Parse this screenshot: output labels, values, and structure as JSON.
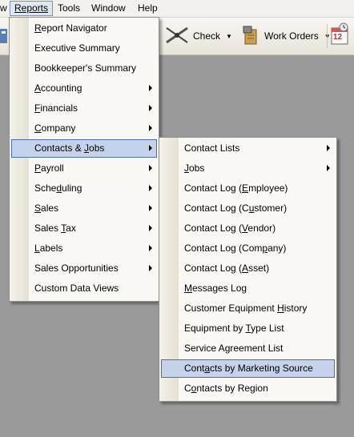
{
  "menubar": {
    "cut_item": "w",
    "items": [
      {
        "label": "Reports"
      },
      {
        "label": "Tools"
      },
      {
        "label": "Window"
      },
      {
        "label": "Help"
      }
    ]
  },
  "toolbar": {
    "check_label": "Check",
    "work_orders_label": "Work Orders",
    "calendar_badge": "12"
  },
  "reports_menu": {
    "items": [
      {
        "label": "Report Navigator",
        "ul": "R",
        "has_submenu": false
      },
      {
        "label": "Executive Summary",
        "ul": "",
        "has_submenu": false
      },
      {
        "label": "Bookkeeper's Summary",
        "ul": "",
        "has_submenu": false
      },
      {
        "label": "Accounting",
        "ul": "A",
        "has_submenu": true
      },
      {
        "label": "Financials",
        "ul": "F",
        "has_submenu": true
      },
      {
        "label": "Company",
        "ul": "C",
        "has_submenu": true
      },
      {
        "label": "Contacts & Jobs",
        "ul": "J",
        "has_submenu": true,
        "selected": true
      },
      {
        "label": "Payroll",
        "ul": "P",
        "has_submenu": true
      },
      {
        "label": "Scheduling",
        "ul": "d",
        "has_submenu": true
      },
      {
        "label": "Sales",
        "ul": "S",
        "has_submenu": true
      },
      {
        "label": "Sales Tax",
        "ul": "T",
        "has_submenu": true
      },
      {
        "label": "Labels",
        "ul": "L",
        "has_submenu": true
      },
      {
        "label": "Sales Opportunities",
        "ul": "",
        "has_submenu": true
      },
      {
        "label": "Custom Data Views",
        "ul": "",
        "has_submenu": false
      }
    ]
  },
  "contacts_menu": {
    "items": [
      {
        "label": "Contact Lists",
        "ul": "",
        "has_submenu": true
      },
      {
        "label": "Jobs",
        "ul": "J",
        "has_submenu": true
      },
      {
        "label": "Contact Log (Employee)",
        "ul": "E",
        "has_submenu": false
      },
      {
        "label": "Contact Log (Customer)",
        "ul": "u",
        "has_submenu": false
      },
      {
        "label": "Contact Log (Vendor)",
        "ul": "V",
        "has_submenu": false
      },
      {
        "label": "Contact Log (Company)",
        "ul": "p",
        "has_submenu": false
      },
      {
        "label": "Contact Log (Asset)",
        "ul": "A",
        "has_submenu": false
      },
      {
        "label": "Messages Log",
        "ul": "M",
        "has_submenu": false
      },
      {
        "label": "Customer Equipment History",
        "ul": "H",
        "has_submenu": false
      },
      {
        "label": "Equipment by Type List",
        "ul": "T",
        "has_submenu": false
      },
      {
        "label": "Service Agreement List",
        "ul": "",
        "has_submenu": false
      },
      {
        "label": "Contacts by Marketing Source",
        "ul": "a",
        "has_submenu": false,
        "selected": true
      },
      {
        "label": "Contacts by Region",
        "ul": "o",
        "has_submenu": false
      }
    ]
  },
  "colors": {
    "desktop": "#9a9a9a",
    "menu_bg": "#f9f8f4",
    "highlight_bg": "#c5d3ea",
    "highlight_border": "#4a6ea9"
  }
}
